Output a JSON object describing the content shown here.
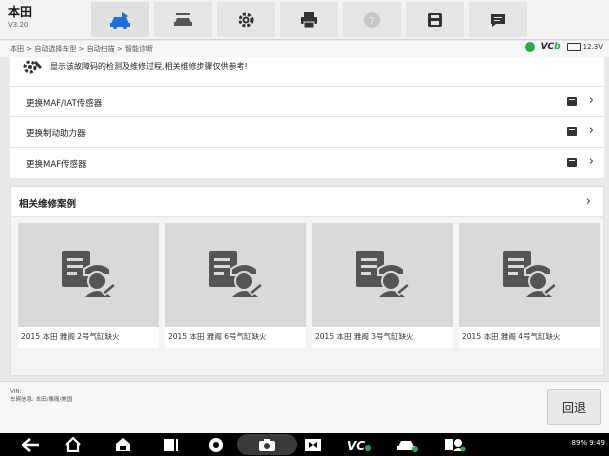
{
  "app": {
    "brand": "本田",
    "version": "V3.20"
  },
  "toolbar": {
    "buttons": [
      {
        "name": "home-car-icon"
      },
      {
        "name": "vehicle-menu-icon"
      },
      {
        "name": "settings-gear-icon"
      },
      {
        "name": "print-icon"
      },
      {
        "name": "help-icon"
      },
      {
        "name": "save-icon"
      },
      {
        "name": "message-icon"
      }
    ]
  },
  "breadcrumb": "本田 > 自动选择车型 > 自动扫描 > 智能诊断",
  "status": {
    "vci": "VC",
    "vci_b": "b",
    "voltage": "12.3V"
  },
  "notice": "显示该故障码的检测及维修过程,相关维修步骤仅供参考!",
  "repair_items": [
    {
      "label": "更换MAF/IAT传感器"
    },
    {
      "label": "更换制动助力器"
    },
    {
      "label": "更换MAF传感器"
    }
  ],
  "cases": {
    "title": "相关维修案例",
    "items": [
      {
        "caption": "2015 本田 雅阁 2号气缸缺火"
      },
      {
        "caption": "2015 本田 雅阁 6号气缸缺火"
      },
      {
        "caption": "2015 本田 雅阁 3号气缸缺火"
      },
      {
        "caption": "2015 本田 雅阁 4号气缸缺火"
      }
    ]
  },
  "footer": {
    "vin_label": "VIN:",
    "vehicle_info": "车辆信息: 本田/雅阁/美国",
    "back_label": "回退"
  },
  "system_status": "89% 9:49"
}
